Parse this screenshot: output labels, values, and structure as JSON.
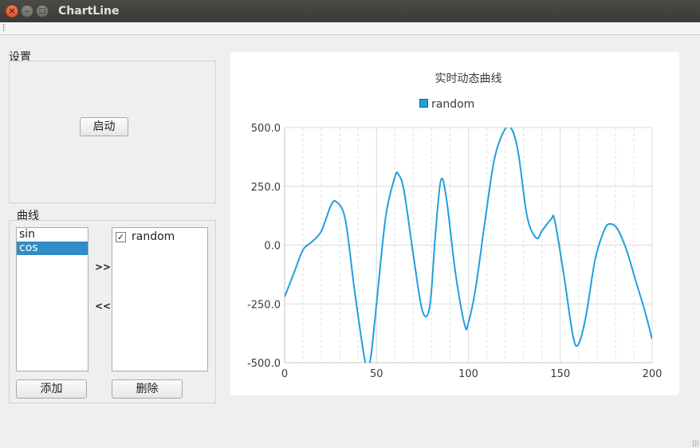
{
  "window": {
    "title": "ChartLine"
  },
  "settings": {
    "title": "设置",
    "start_label": "启动"
  },
  "curves": {
    "title": "曲线",
    "available": [
      "sin",
      "cos"
    ],
    "selected_index": 1,
    "add_arrow": ">>",
    "remove_arrow": "<<",
    "active": [
      {
        "label": "random",
        "checked": true,
        "check_mark": "✓"
      }
    ],
    "add_label": "添加",
    "delete_label": "删除"
  },
  "chart_data": {
    "type": "line",
    "title": "实时动态曲线",
    "legend_placement": "top",
    "xlim": [
      0,
      200
    ],
    "ylim": [
      -500,
      500
    ],
    "x_ticks": [
      "0",
      "50",
      "100",
      "150",
      "200"
    ],
    "y_ticks": [
      "500.0",
      "250.0",
      "0.0",
      "-250.0",
      "-500.0"
    ],
    "grid": true,
    "series": [
      {
        "name": "random",
        "color": "#209fdf",
        "x": [
          0,
          5,
          10,
          15,
          20,
          25,
          28,
          33,
          38,
          43,
          45,
          47,
          50,
          55,
          60,
          62,
          65,
          70,
          75,
          79,
          82,
          85,
          88,
          93,
          98,
          100,
          104,
          109,
          114,
          119,
          123,
          127,
          132,
          137,
          140,
          145,
          147,
          152,
          157,
          160,
          164,
          169,
          174,
          177,
          181,
          186,
          191,
          196,
          200
        ],
        "y": [
          -220,
          -120,
          -20,
          15,
          60,
          165,
          185,
          110,
          -190,
          -460,
          -520,
          -470,
          -250,
          120,
          290,
          300,
          230,
          -40,
          -280,
          -260,
          40,
          275,
          200,
          -120,
          -340,
          -330,
          -180,
          100,
          360,
          480,
          500,
          400,
          120,
          30,
          60,
          110,
          105,
          -130,
          -390,
          -420,
          -300,
          -60,
          65,
          90,
          70,
          -20,
          -150,
          -280,
          -400
        ]
      }
    ]
  }
}
